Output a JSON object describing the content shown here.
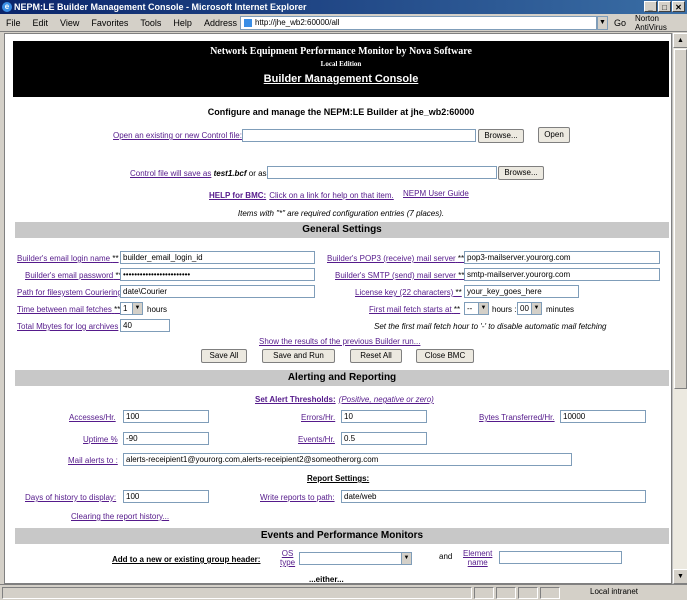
{
  "window": {
    "title": "NEPM:LE Builder Management Console - Microsoft Internet Explorer"
  },
  "menu": [
    "File",
    "Edit",
    "View",
    "Favorites",
    "Tools",
    "Help"
  ],
  "address": {
    "label": "Address",
    "url": "http://jhe_wb2:60000/all",
    "go": "Go",
    "norton": "Norton AntiVirus"
  },
  "status": {
    "zone": "Local intranet"
  },
  "banner": {
    "title": "Network Equipment Performance Monitor by Nova Software",
    "edition": "Local Edition",
    "console": "Builder Management Console"
  },
  "header": {
    "configure": "Configure and manage the NEPM:LE Builder at jhe_wb2:60000",
    "open_link": "Open an existing or new Control file:",
    "browse": "Browse...",
    "open_btn": "Open",
    "save_prefix": "Control file will save as",
    "save_file": "test1.bcf",
    "save_or": "or as",
    "help_label": "HELP for BMC:",
    "help_text": "Click on a link for help on that item.",
    "user_guide": "NEPM User Guide",
    "required_note": "Items with \"*\" are required configuration entries (7 places)."
  },
  "general": {
    "heading": "General Settings",
    "email_login_label": "Builder's email login name",
    "email_login_value": "builder_email_login_id",
    "email_password_label": "Builder's email password",
    "email_password_value": "xxxxxxxxxxxxxxxxxxxxxxxx",
    "fs_path_label": "Path for filesystem Couriering",
    "fs_path_value": "date\\Courier",
    "fetch_label": "Time between mail fetches",
    "fetch_value": "1",
    "fetch_unit": "hours",
    "mbytes_label": "Total Mbytes for log archives",
    "mbytes_value": "40",
    "pop3_label": "Builder's POP3 (receive) mail server",
    "pop3_value": "pop3-mailserver.yourorg.com",
    "smtp_label": "Builder's SMTP (send) mail server",
    "smtp_value": "smtp-mailserver.yourorg.com",
    "license_label": "License key (22 characters)",
    "license_value": "your_key_goes_here",
    "first_fetch_label": "First mail fetch starts at",
    "first_fetch_hour": "--",
    "hours_sep": "hours :",
    "first_fetch_min": "00",
    "minutes": "minutes",
    "fetch_note": "Set the first mail fetch hour to '-' to disable automatic mail fetching",
    "show_results": "Show the results of the previous Builder run...",
    "save_all": "Save All",
    "save_run": "Save and Run",
    "reset_all": "Reset All",
    "close_bmc": "Close BMC"
  },
  "alerting": {
    "heading": "Alerting and Reporting",
    "thresholds": "Set Alert Thresholds:",
    "thresholds_note": "(Positive, negative or zero)",
    "accesses_label": "Accesses/Hr.",
    "accesses_value": "100",
    "errors_label": "Errors/Hr.",
    "errors_value": "10",
    "bytes_label": "Bytes Transferred/Hr.",
    "bytes_value": "10000",
    "uptime_label": "Uptime %",
    "uptime_value": "-90",
    "events_label": "Events/Hr.",
    "events_value": "0.5",
    "mail_alerts_label": "Mail alerts to :",
    "mail_alerts_value": "alerts-receipient1@yourorg.com,alerts-receipient2@someotherorg.com",
    "report_settings": "Report Settings:",
    "days_label": "Days of history to display:",
    "days_value": "100",
    "write_label": "Write reports to path:",
    "write_value": "date/web",
    "clearing": "Clearing the report history..."
  },
  "events": {
    "heading": "Events and Performance Monitors",
    "add_group": "Add to a new or existing group header:",
    "os_label": "OS",
    "type_label": "type",
    "and": "and",
    "element_label": "Element",
    "name_label": "name",
    "either": "...either..."
  }
}
